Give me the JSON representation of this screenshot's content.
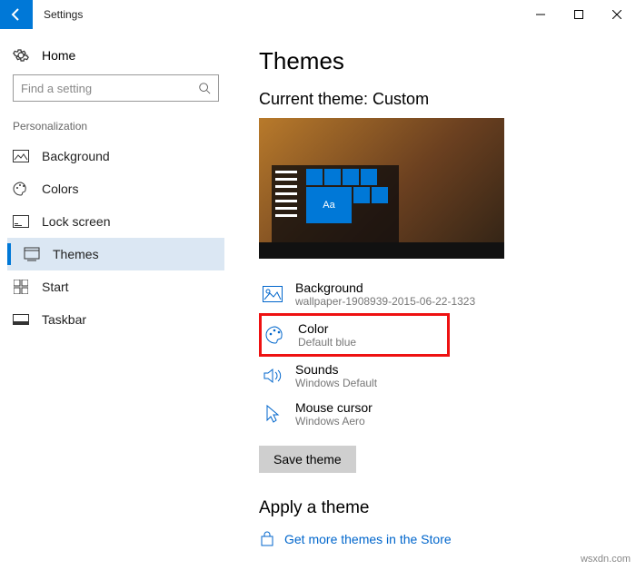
{
  "app": {
    "title": "Settings"
  },
  "home": {
    "label": "Home"
  },
  "search": {
    "placeholder": "Find a setting"
  },
  "category": {
    "label": "Personalization"
  },
  "nav": {
    "items": [
      {
        "label": "Background"
      },
      {
        "label": "Colors"
      },
      {
        "label": "Lock screen"
      },
      {
        "label": "Themes"
      },
      {
        "label": "Start"
      },
      {
        "label": "Taskbar"
      }
    ]
  },
  "page": {
    "title": "Themes",
    "current_theme_label": "Current theme: Custom",
    "preview_tile_text": "Aa",
    "options": {
      "background": {
        "title": "Background",
        "sub": "wallpaper-1908939-2015-06-22-1323"
      },
      "color": {
        "title": "Color",
        "sub": "Default blue"
      },
      "sounds": {
        "title": "Sounds",
        "sub": "Windows Default"
      },
      "cursor": {
        "title": "Mouse cursor",
        "sub": "Windows Aero"
      }
    },
    "save_label": "Save theme",
    "apply_heading": "Apply a theme",
    "store_link": "Get more themes in the Store"
  },
  "watermark": "wsxdn.com"
}
